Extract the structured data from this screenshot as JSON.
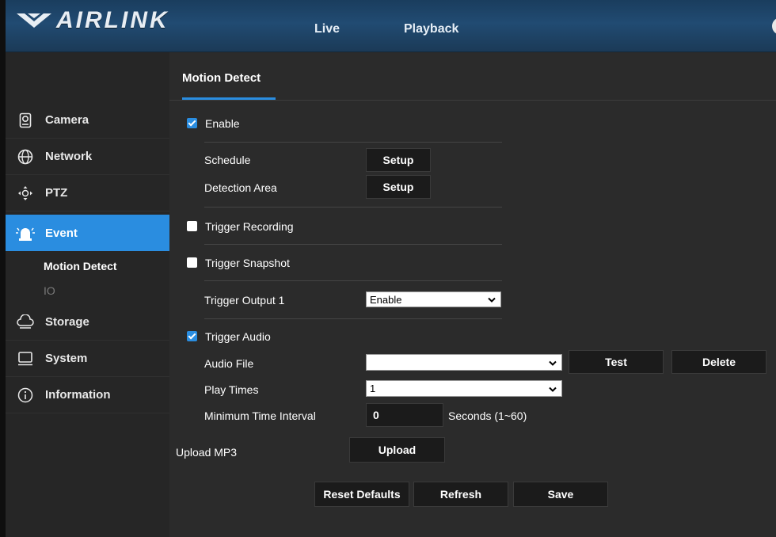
{
  "header": {
    "logo_text": "AIRLINK",
    "nav": {
      "live": "Live",
      "playback": "Playback"
    }
  },
  "sidebar": {
    "items": [
      {
        "label": "Camera",
        "icon": "camera-icon"
      },
      {
        "label": "Network",
        "icon": "network-globe-icon"
      },
      {
        "label": "PTZ",
        "icon": "ptz-arrows-icon"
      },
      {
        "label": "Event",
        "icon": "alarm-siren-icon"
      },
      {
        "label": "Storage",
        "icon": "storage-cloud-icon"
      },
      {
        "label": "System",
        "icon": "monitor-icon"
      },
      {
        "label": "Information",
        "icon": "info-icon"
      }
    ],
    "sub_items": [
      "Motion Detect",
      "IO"
    ],
    "active_color": "#2a8de0"
  },
  "main": {
    "tab": "Motion Detect",
    "enable": {
      "label": "Enable",
      "checked": true
    },
    "schedule": {
      "label": "Schedule",
      "button": "Setup"
    },
    "detection_area": {
      "label": "Detection Area",
      "button": "Setup"
    },
    "trigger_recording": {
      "label": "Trigger Recording",
      "checked": false
    },
    "trigger_snapshot": {
      "label": "Trigger Snapshot",
      "checked": false
    },
    "trigger_output": {
      "label": "Trigger Output 1",
      "value": "Enable"
    },
    "trigger_audio": {
      "label": "Trigger Audio",
      "checked": true
    },
    "audio_file": {
      "label": "Audio File",
      "value": "",
      "test": "Test",
      "delete": "Delete"
    },
    "play_times": {
      "label": "Play Times",
      "value": "1"
    },
    "min_interval": {
      "label": "Minimum Time Interval",
      "value": "0",
      "unit": "Seconds (1~60)"
    },
    "upload": {
      "label": "Upload MP3",
      "button": "Upload"
    },
    "actions": {
      "reset": "Reset Defaults",
      "refresh": "Refresh",
      "save": "Save"
    }
  }
}
